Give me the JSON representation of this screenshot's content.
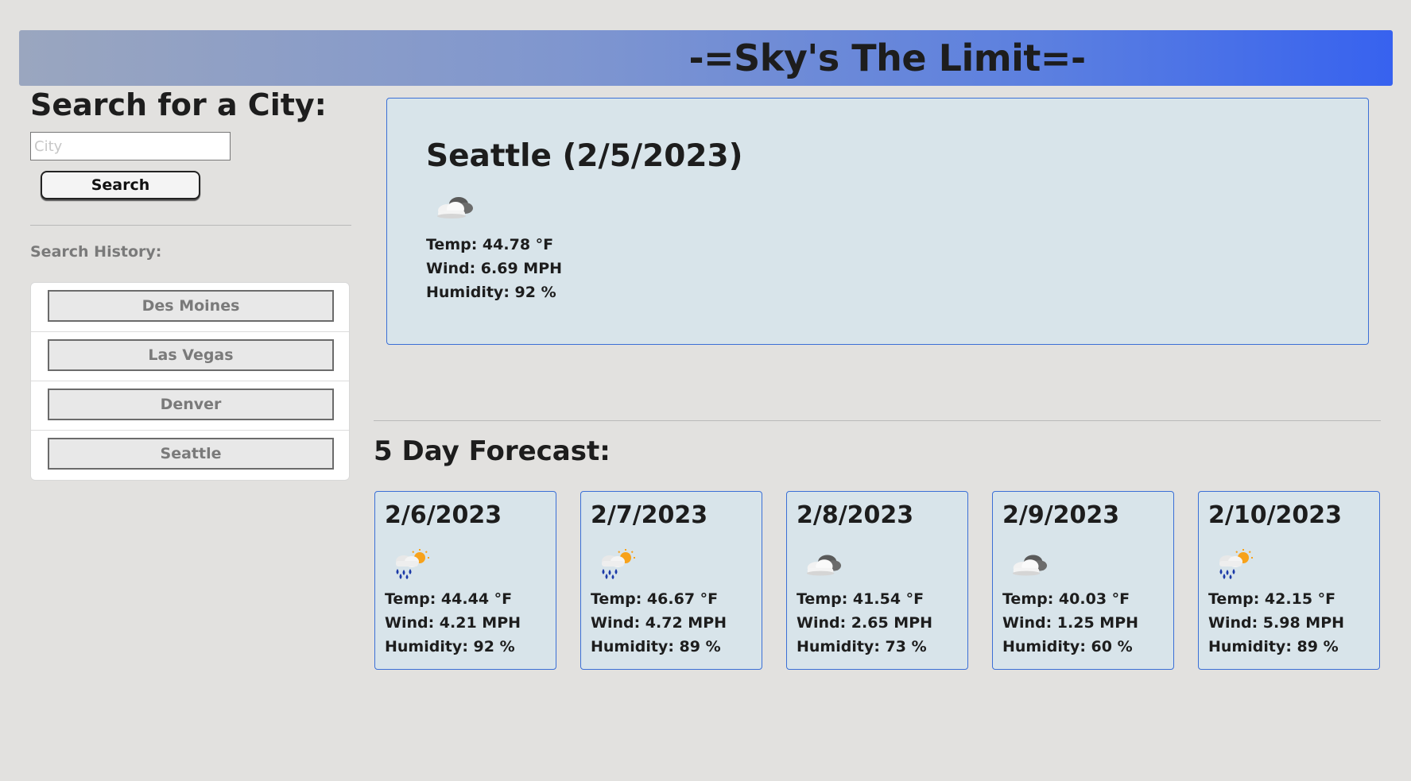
{
  "header": {
    "title": "-=Sky's The Limit=-"
  },
  "search": {
    "title": "Search for a City:",
    "placeholder": "City",
    "value": "",
    "button_label": "Search"
  },
  "history": {
    "label": "Search History:",
    "items": [
      {
        "label": "Des Moines"
      },
      {
        "label": "Las Vegas"
      },
      {
        "label": "Denver"
      },
      {
        "label": "Seattle"
      }
    ]
  },
  "current": {
    "city_date": "Seattle (2/5/2023)",
    "icon": "cloudy-icon",
    "temp": "Temp: 44.78 °F",
    "wind": "Wind: 6.69 MPH",
    "humidity": "Humidity: 92 %"
  },
  "forecast": {
    "title": "5 Day Forecast:",
    "days": [
      {
        "date": "2/6/2023",
        "icon": "rain-sun-icon",
        "temp": "Temp: 44.44 °F",
        "wind": "Wind: 4.21 MPH",
        "humidity": "Humidity: 92 %"
      },
      {
        "date": "2/7/2023",
        "icon": "rain-sun-icon",
        "temp": "Temp: 46.67 °F",
        "wind": "Wind: 4.72 MPH",
        "humidity": "Humidity: 89 %"
      },
      {
        "date": "2/8/2023",
        "icon": "cloudy-icon",
        "temp": "Temp: 41.54 °F",
        "wind": "Wind: 2.65 MPH",
        "humidity": "Humidity: 73 %"
      },
      {
        "date": "2/9/2023",
        "icon": "cloudy-icon",
        "temp": "Temp: 40.03 °F",
        "wind": "Wind: 1.25 MPH",
        "humidity": "Humidity: 60 %"
      },
      {
        "date": "2/10/2023",
        "icon": "rain-sun-icon",
        "temp": "Temp: 42.15 °F",
        "wind": "Wind: 5.98 MPH",
        "humidity": "Humidity: 89 %"
      }
    ]
  },
  "colors": {
    "background": "#e2e1df",
    "header_start": "#9aa6bf",
    "header_end": "#3762ef",
    "card_bg": "#d8e4ea",
    "card_border": "#3b6fd6"
  }
}
